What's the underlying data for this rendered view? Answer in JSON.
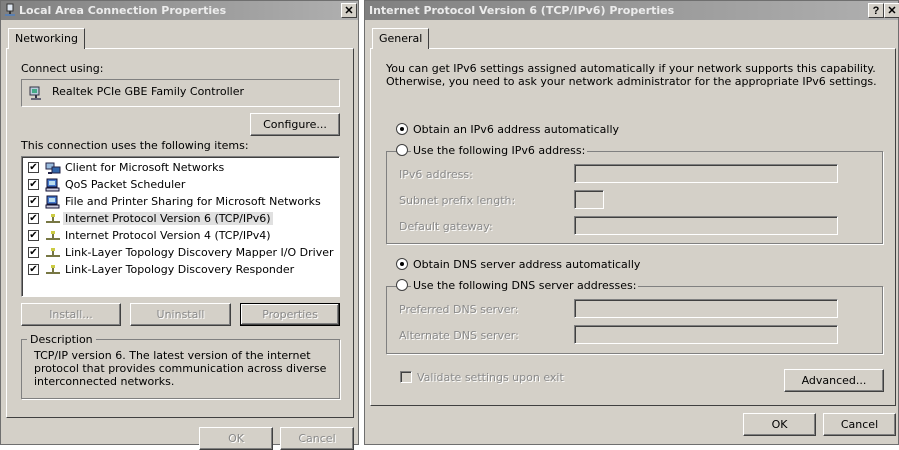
{
  "left_window": {
    "title": "Local Area Connection Properties",
    "close_label": "✕",
    "tab_networking": "Networking",
    "connect_using_label": "Connect using:",
    "adapter_name": "Realtek PCIe GBE Family Controller",
    "configure_label": "Configure...",
    "items_label": "This connection uses the following items:",
    "items": [
      {
        "label": "Client for Microsoft Networks",
        "checked": true,
        "icon": "network-client-icon"
      },
      {
        "label": "QoS Packet Scheduler",
        "checked": true,
        "icon": "network-service-icon"
      },
      {
        "label": "File and Printer Sharing for Microsoft Networks",
        "checked": true,
        "icon": "network-service-icon"
      },
      {
        "label": "Internet Protocol Version 6 (TCP/IPv6)",
        "checked": true,
        "icon": "network-protocol-icon",
        "selected": true
      },
      {
        "label": "Internet Protocol Version 4 (TCP/IPv4)",
        "checked": true,
        "icon": "network-protocol-icon"
      },
      {
        "label": "Link-Layer Topology Discovery Mapper I/O Driver",
        "checked": true,
        "icon": "network-protocol-icon"
      },
      {
        "label": "Link-Layer Topology Discovery Responder",
        "checked": true,
        "icon": "network-protocol-icon"
      }
    ],
    "install_label": "Install...",
    "uninstall_label": "Uninstall",
    "properties_label": "Properties",
    "description_title": "Description",
    "description_text": "TCP/IP version 6. The latest version of the internet protocol that provides communication across diverse interconnected networks.",
    "ok_label": "OK",
    "cancel_label": "Cancel"
  },
  "right_window": {
    "title": "Internet Protocol Version 6 (TCP/IPv6) Properties",
    "help_label": "?",
    "close_label": "✕",
    "tab_general": "General",
    "intro_line1": "You can get IPv6 settings assigned automatically if your network supports this capability.",
    "intro_line2": "Otherwise, you need to ask your network administrator for the appropriate IPv6 settings.",
    "radio_auto_ip": "Obtain an IPv6 address automatically",
    "radio_manual_ip": "Use the following IPv6 address:",
    "ipv6_address_label": "IPv6 address:",
    "subnet_prefix_label": "Subnet prefix length:",
    "default_gateway_label": "Default gateway:",
    "radio_auto_dns": "Obtain DNS server address automatically",
    "radio_manual_dns": "Use the following DNS server addresses:",
    "preferred_dns_label": "Preferred DNS server:",
    "alternate_dns_label": "Alternate DNS server:",
    "validate_label": "Validate settings upon exit",
    "advanced_label": "Advanced...",
    "ok_label": "OK",
    "cancel_label": "Cancel",
    "auto_ip_selected": true,
    "auto_dns_selected": true,
    "validate_checked": false
  }
}
